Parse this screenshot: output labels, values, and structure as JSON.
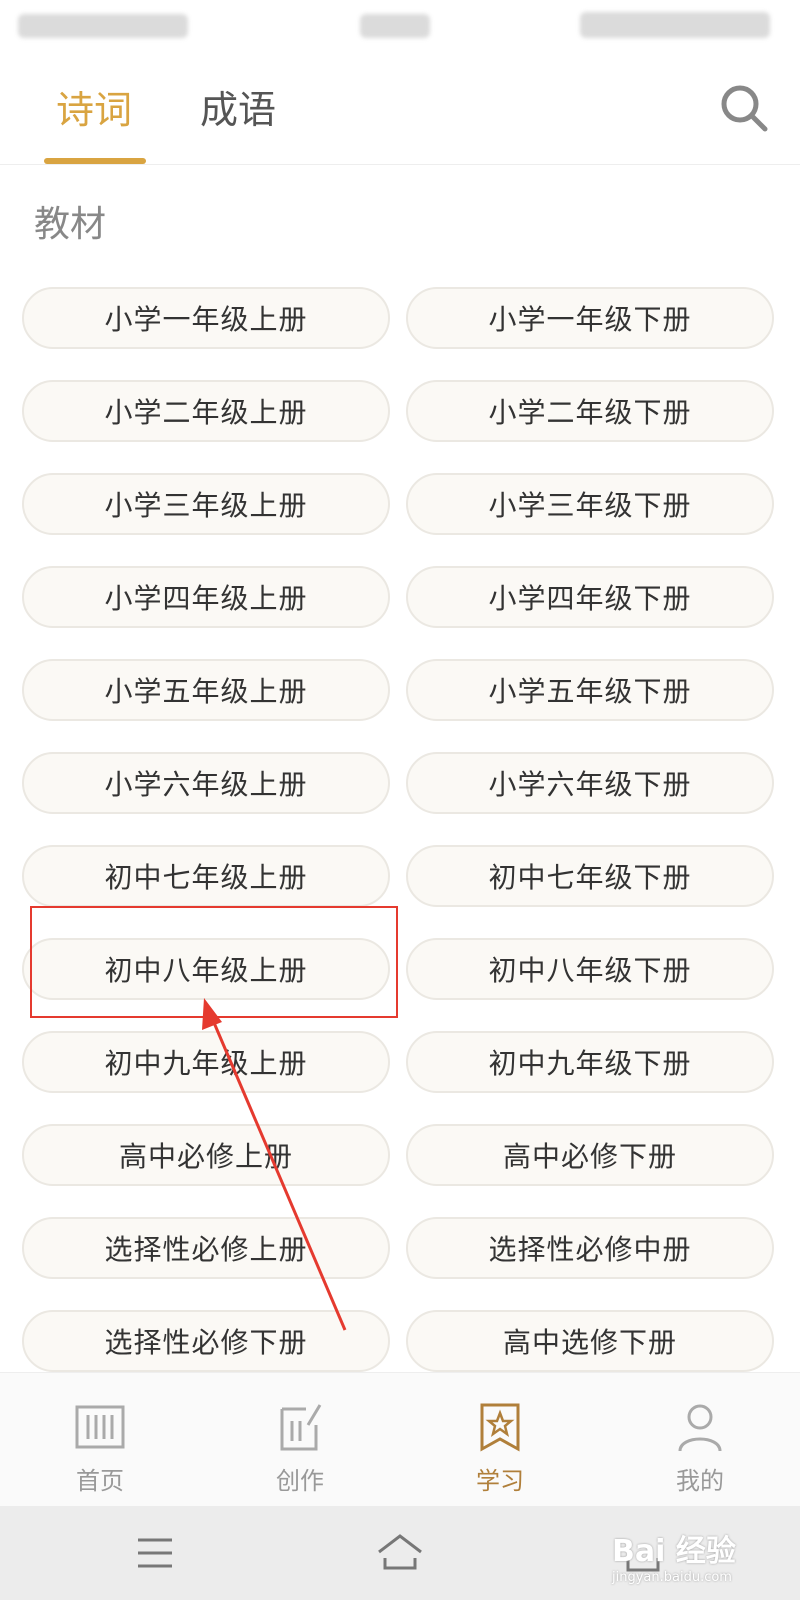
{
  "top_tabs": [
    {
      "label": "诗词",
      "active": true
    },
    {
      "label": "成语",
      "active": false
    }
  ],
  "section_title": "教材",
  "books": [
    "小学一年级上册",
    "小学一年级下册",
    "小学二年级上册",
    "小学二年级下册",
    "小学三年级上册",
    "小学三年级下册",
    "小学四年级上册",
    "小学四年级下册",
    "小学五年级上册",
    "小学五年级下册",
    "小学六年级上册",
    "小学六年级下册",
    "初中七年级上册",
    "初中七年级下册",
    "初中八年级上册",
    "初中八年级下册",
    "初中九年级上册",
    "初中九年级下册",
    "高中必修上册",
    "高中必修下册",
    "选择性必修上册",
    "选择性必修中册",
    "选择性必修下册",
    "高中选修下册"
  ],
  "highlighted_book": "初中八年级上册",
  "bottom_nav": [
    {
      "label": "首页",
      "icon": "book-icon",
      "active": false
    },
    {
      "label": "创作",
      "icon": "edit-icon",
      "active": false
    },
    {
      "label": "学习",
      "icon": "bookmark-star-icon",
      "active": true
    },
    {
      "label": "我的",
      "icon": "person-icon",
      "active": false
    }
  ],
  "watermark": {
    "logo": "Bai 经验",
    "url": "jingyan.baidu.com"
  },
  "colors": {
    "accent": "#d9a441",
    "annotation": "#e53a2f",
    "active_nav": "#b07f3a"
  }
}
